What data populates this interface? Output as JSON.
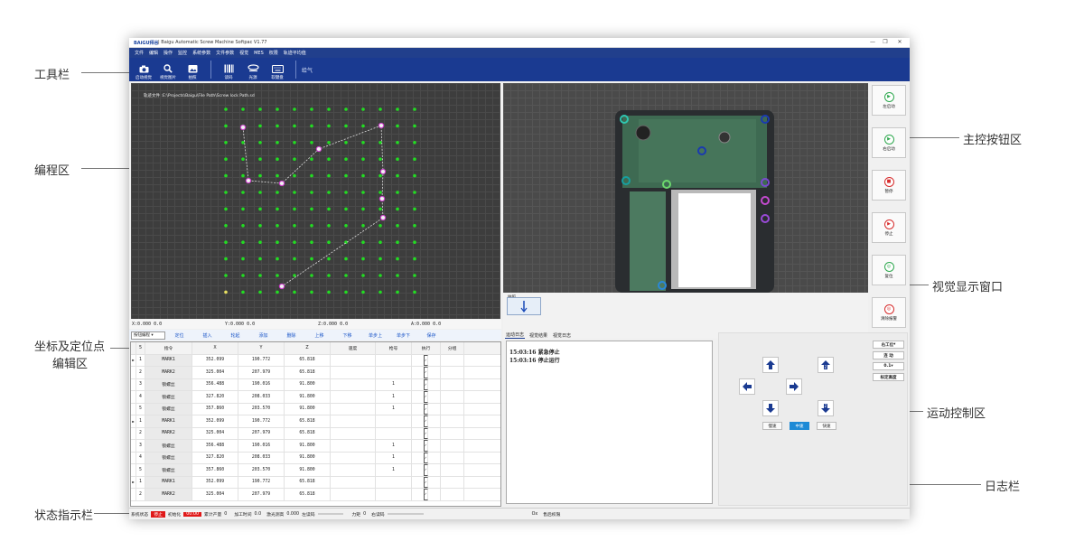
{
  "callouts": {
    "toolbar": "工具栏",
    "programming": "编程区",
    "coord_edit_line1": "坐标及定位点",
    "coord_edit_line2": "编辑区",
    "status": "状态指示栏",
    "main_buttons": "主控按钮区",
    "vision": "视觉显示窗口",
    "motion": "运动控制区",
    "log": "日志栏"
  },
  "app": {
    "brand": "BAiGU拜谷",
    "title": "| Baigu Automatic Screw Machine Softpac V1.77",
    "window_controls": [
      "—",
      "❐",
      "✕"
    ]
  },
  "menu": [
    "文件",
    "编辑",
    "操作",
    "监控",
    "系统参数",
    "文件参数",
    "视觉",
    "MES",
    "权限",
    "轨迹平均值"
  ],
  "toolbar": {
    "buttons": [
      {
        "label": "启动视觉",
        "icon": "camera-icon"
      },
      {
        "label": "视觉图片",
        "icon": "search-icon"
      },
      {
        "label": "拍照",
        "icon": "photo-icon"
      },
      {
        "label": "读码",
        "icon": "barcode-icon"
      },
      {
        "label": "光源",
        "icon": "light-icon"
      },
      {
        "label": "软键盘",
        "icon": "keyboard-icon"
      }
    ],
    "extra": "给气"
  },
  "programming": {
    "path": "轨迹文件 :E:\\Projects\\Baigu\\File Path\\Screw lock Path.sd"
  },
  "coords": [
    "X:0.000 0.0",
    "Y:0.000 0.0",
    "Z:0.000 0.0",
    "A:0.000 0.0"
  ],
  "edit_toolbar": {
    "mode": "按钮编程",
    "buttons": [
      "定位",
      "插入",
      "轮起",
      "添加",
      "删除",
      "上移",
      "下移",
      "单步上",
      "单步下",
      "保存"
    ]
  },
  "table": {
    "headers": [
      "5",
      "指令",
      "X",
      "Y",
      "Z",
      "速度",
      "枪号",
      "执行",
      "分组"
    ],
    "rows": [
      {
        "marker": "▶",
        "no": "1",
        "ins": "MARK1",
        "x": "352.099",
        "y": "190.772",
        "z": "65.818",
        "gun": ""
      },
      {
        "marker": "",
        "no": "2",
        "ins": "MARK2",
        "x": "325.004",
        "y": "207.979",
        "z": "65.818",
        "gun": ""
      },
      {
        "marker": "",
        "no": "3",
        "ins": "锁螺丝",
        "x": "356.488",
        "y": "190.016",
        "z": "91.800",
        "gun": "1"
      },
      {
        "marker": "",
        "no": "4",
        "ins": "锁螺丝",
        "x": "327.820",
        "y": "208.033",
        "z": "91.800",
        "gun": "1"
      },
      {
        "marker": "",
        "no": "5",
        "ins": "锁螺丝",
        "x": "357.860",
        "y": "203.570",
        "z": "91.800",
        "gun": "1"
      },
      {
        "marker": "▶",
        "no": "1",
        "ins": "MARK1",
        "x": "352.099",
        "y": "190.772",
        "z": "65.818",
        "gun": ""
      },
      {
        "marker": "",
        "no": "2",
        "ins": "MARK2",
        "x": "325.004",
        "y": "207.979",
        "z": "65.818",
        "gun": ""
      },
      {
        "marker": "",
        "no": "3",
        "ins": "锁螺丝",
        "x": "356.488",
        "y": "190.016",
        "z": "91.800",
        "gun": "1"
      },
      {
        "marker": "",
        "no": "4",
        "ins": "锁螺丝",
        "x": "327.820",
        "y": "208.033",
        "z": "91.800",
        "gun": "1"
      },
      {
        "marker": "",
        "no": "5",
        "ins": "锁螺丝",
        "x": "357.860",
        "y": "203.570",
        "z": "91.800",
        "gun": "1"
      },
      {
        "marker": "▶",
        "no": "1",
        "ins": "MARK1",
        "x": "352.099",
        "y": "190.772",
        "z": "65.818",
        "gun": ""
      },
      {
        "marker": "",
        "no": "2",
        "ins": "MARK2",
        "x": "325.004",
        "y": "207.979",
        "z": "65.818",
        "gun": ""
      }
    ]
  },
  "log": {
    "tabs": [
      "运动日志",
      "视觉结果",
      "视觉日志"
    ],
    "lines": [
      "15:03:16 紧急停止",
      "15:03:16 停止运行"
    ]
  },
  "main_buttons": [
    {
      "label": "左启动",
      "color": "#2fa84f",
      "glyph": "▶"
    },
    {
      "label": "右启动",
      "color": "#2fa84f",
      "glyph": "▶"
    },
    {
      "label": "暂停",
      "color": "#d62c2c",
      "glyph": "■"
    },
    {
      "label": "停止",
      "color": "#d62c2c",
      "glyph": "▶"
    },
    {
      "label": "复位",
      "color": "#2fa84f",
      "glyph": "◎"
    },
    {
      "label": "清除报警",
      "color": "#d62c2c",
      "glyph": "◎"
    }
  ],
  "motion": {
    "speeds": [
      "慢速",
      "中速",
      "快速"
    ],
    "active_speed": "中速",
    "settings": [
      "右工位",
      "连 动",
      "0.1",
      "标定高度"
    ]
  },
  "status": {
    "sys_label": "系统状态",
    "sys_value": "停止",
    "init_label": "初始化",
    "init_value": "00:00",
    "count_label": "累计产量",
    "count_value": "0",
    "time_label": "加工时间",
    "time_value": "0.0",
    "dist_label": "激光测高",
    "dist_value": "0.000",
    "left_label": "左读码",
    "force_label": "力矩",
    "force_value": "0",
    "right_label": "右读码",
    "user_code": "Ox",
    "user": "售后权限"
  }
}
